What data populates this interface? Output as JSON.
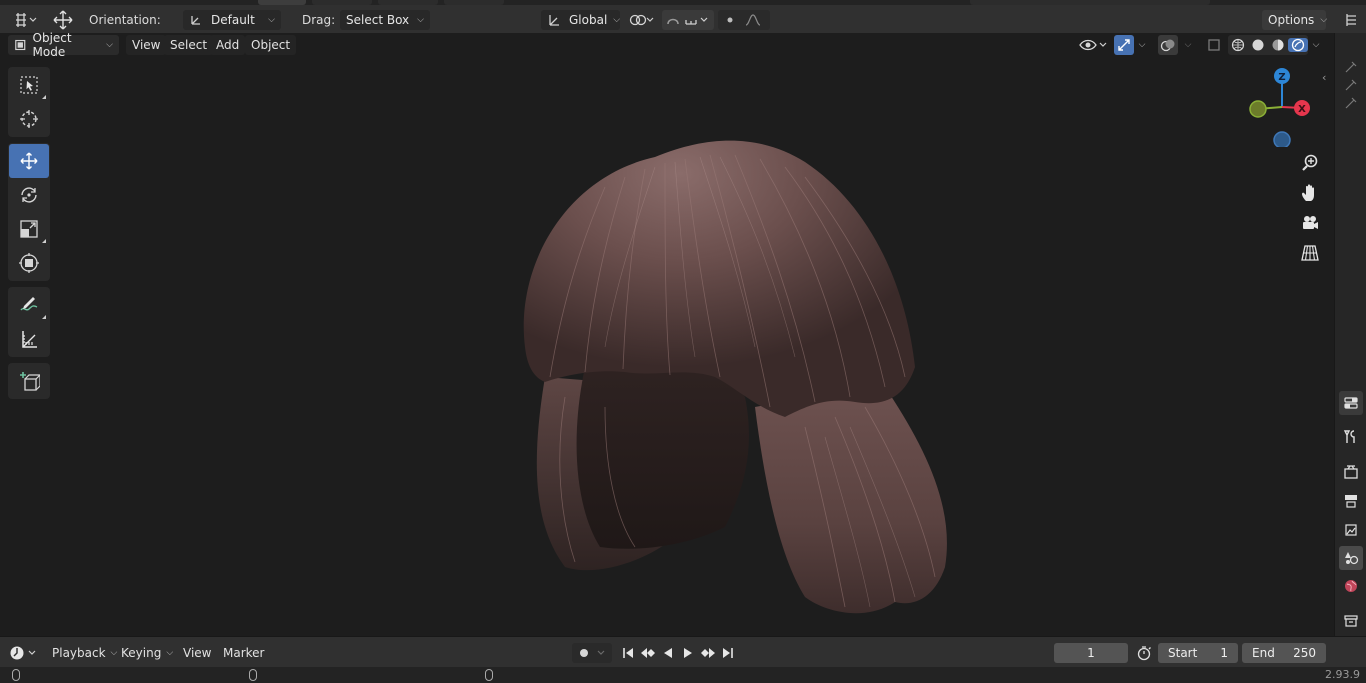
{
  "header": {
    "orientation_label": "Orientation:",
    "orientation_value": "Default",
    "drag_label": "Drag:",
    "drag_value": "Select Box",
    "transform_orientation": "Global",
    "options_label": "Options"
  },
  "viewport_header": {
    "mode": "Object Mode",
    "menus": [
      "View",
      "Select",
      "Add",
      "Object"
    ]
  },
  "toolbar": {
    "tools": [
      "select-box",
      "cursor",
      "move",
      "rotate",
      "scale",
      "transform",
      "annotate",
      "measure",
      "add-cube"
    ],
    "active_tool": "move"
  },
  "gizmo": {
    "z_label": "Z",
    "x_label": "X",
    "colors": {
      "x": "#e5364d",
      "y": "#8bb036",
      "z": "#2d86d6"
    }
  },
  "navigation_icons": [
    "zoom-icon",
    "pan-hand-icon",
    "camera-icon",
    "grid-icon"
  ],
  "properties_tabs": [
    "tool-icon",
    "render-icon",
    "output-icon",
    "view-layer-icon",
    "scene-icon",
    "world-icon",
    "collection-icon"
  ],
  "timeline": {
    "menus": [
      "Playback",
      "Keying",
      "View",
      "Marker"
    ],
    "current_frame": "1",
    "start_label": "Start",
    "start_value": "1",
    "end_label": "End",
    "end_value": "250"
  },
  "status": {
    "version": "2.93.9"
  },
  "colors": {
    "accent": "#4772b3",
    "background": "#1d1d1d",
    "panel": "#303030"
  }
}
